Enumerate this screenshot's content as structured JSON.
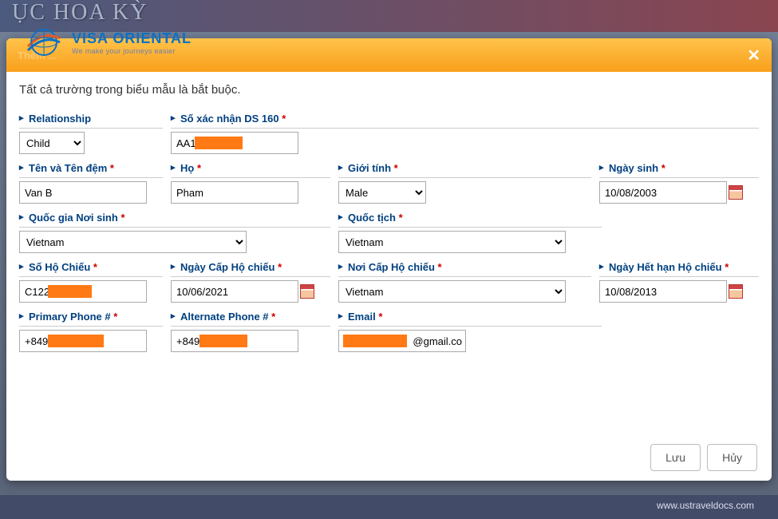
{
  "background": {
    "title_fragment": "ỤC HOA KỲ",
    "footer_url": "www.ustraveldocs.com"
  },
  "logo": {
    "main": "VISA ORIENTAL",
    "sub": "We make your journeys easier"
  },
  "modal": {
    "title": "Thêm ...",
    "note": "Tất cả trường trong biểu mẫu là bắt buộc.",
    "labels": {
      "relationship": "Relationship",
      "ds160": "Số xác nhận DS 160",
      "first_middle": "Tên và Tên đệm",
      "last": "Họ",
      "gender": "Giới tính",
      "dob": "Ngày sinh",
      "birth_country": "Quốc gia Nơi sinh",
      "nationality": "Quốc tịch",
      "passport_no": "Số Hộ Chiếu",
      "passport_issue": "Ngày Cấp Hộ chiếu",
      "passport_place": "Nơi Cấp Hộ chiếu",
      "passport_expiry": "Ngày Hết hạn Hộ chiếu",
      "primary_phone": "Primary Phone #",
      "alt_phone": "Alternate Phone #",
      "email": "Email"
    },
    "values": {
      "relationship": "Child",
      "ds160": "AA1",
      "first_middle": "Van B",
      "last": "Pham",
      "gender": "Male",
      "dob": "10/08/2003",
      "birth_country": "Vietnam",
      "nationality": "Vietnam",
      "passport_no": "C122",
      "passport_issue": "10/06/2021",
      "passport_place": "Vietnam",
      "passport_expiry": "10/08/2013",
      "primary_phone": "+849",
      "alt_phone": "+849",
      "email_suffix": "@gmail.co"
    },
    "buttons": {
      "save": "Lưu",
      "cancel": "Hủy"
    }
  }
}
